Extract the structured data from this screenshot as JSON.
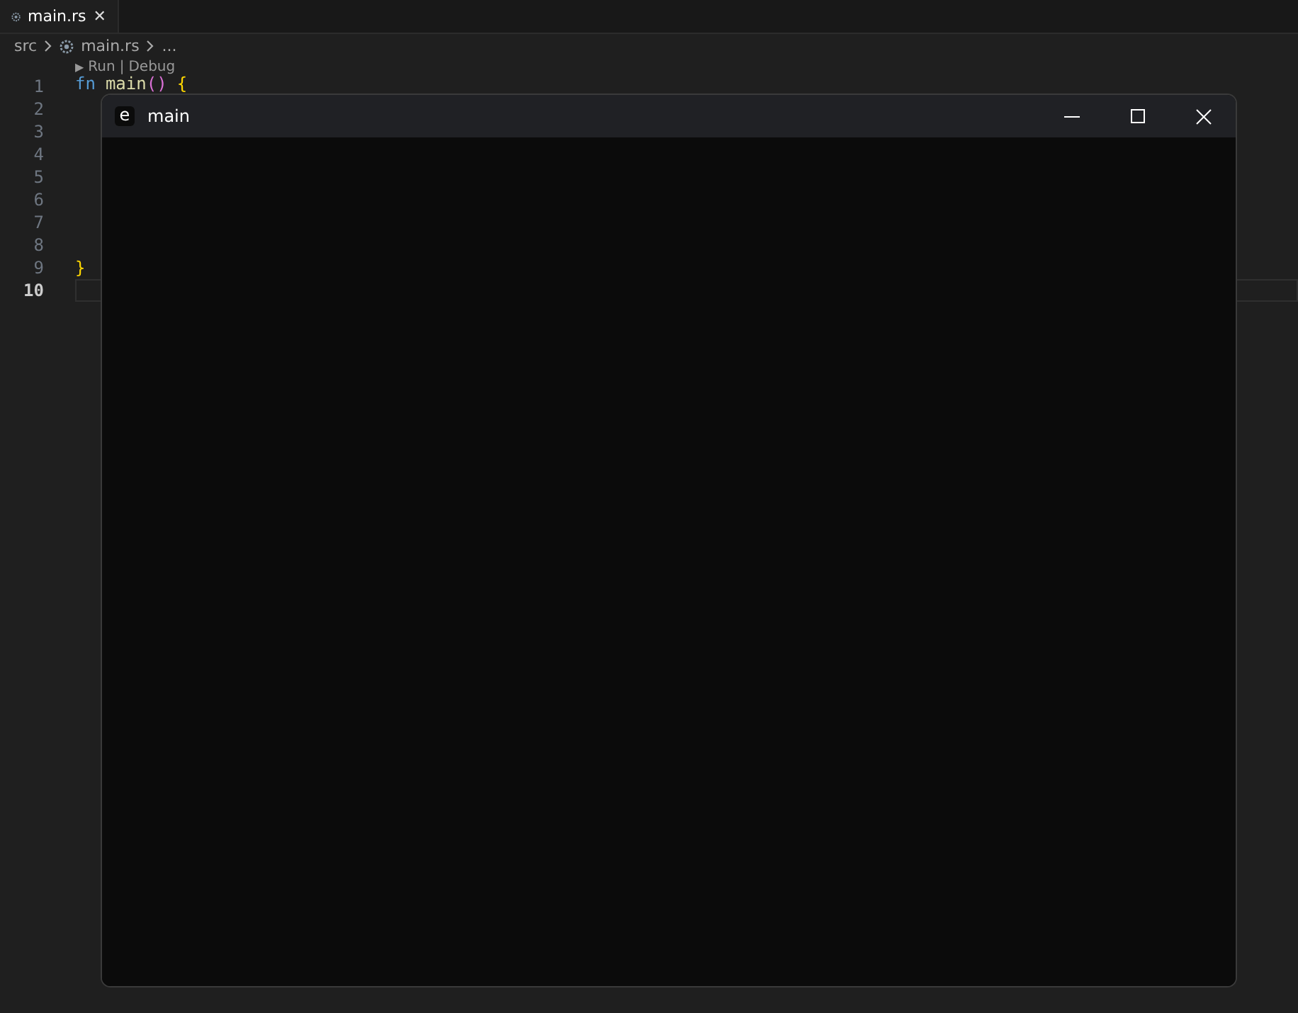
{
  "tabs": [
    {
      "label": "main.rs",
      "selected": true,
      "close": "✕"
    }
  ],
  "breadcrumbs": [
    {
      "label": "src",
      "kind": "folder"
    },
    {
      "label": "main.rs",
      "kind": "file"
    },
    {
      "label": "...",
      "kind": "more"
    }
  ],
  "codelens": {
    "marker": "▶",
    "run": "Run",
    "separator": "|",
    "debug": "Debug"
  },
  "lines": [
    {
      "number": "1",
      "active": false,
      "tokens": [
        {
          "text": "fn",
          "kind": "keyword"
        },
        {
          "text": "main",
          "kind": "function"
        },
        {
          "text": "()",
          "kind": "paren"
        },
        {
          "text": "{",
          "kind": "brace"
        }
      ]
    },
    {
      "number": "2",
      "active": false
    },
    {
      "number": "3",
      "active": false
    },
    {
      "number": "4",
      "active": false
    },
    {
      "number": "5",
      "active": false
    },
    {
      "number": "6",
      "active": false
    },
    {
      "number": "7",
      "active": false
    },
    {
      "number": "8",
      "active": false
    },
    {
      "number": "9",
      "active": false,
      "tokens": [
        {
          "text": "}",
          "kind": "brace"
        }
      ]
    },
    {
      "number": "10",
      "active": true
    }
  ],
  "window": {
    "icon": "e",
    "title": "main"
  }
}
